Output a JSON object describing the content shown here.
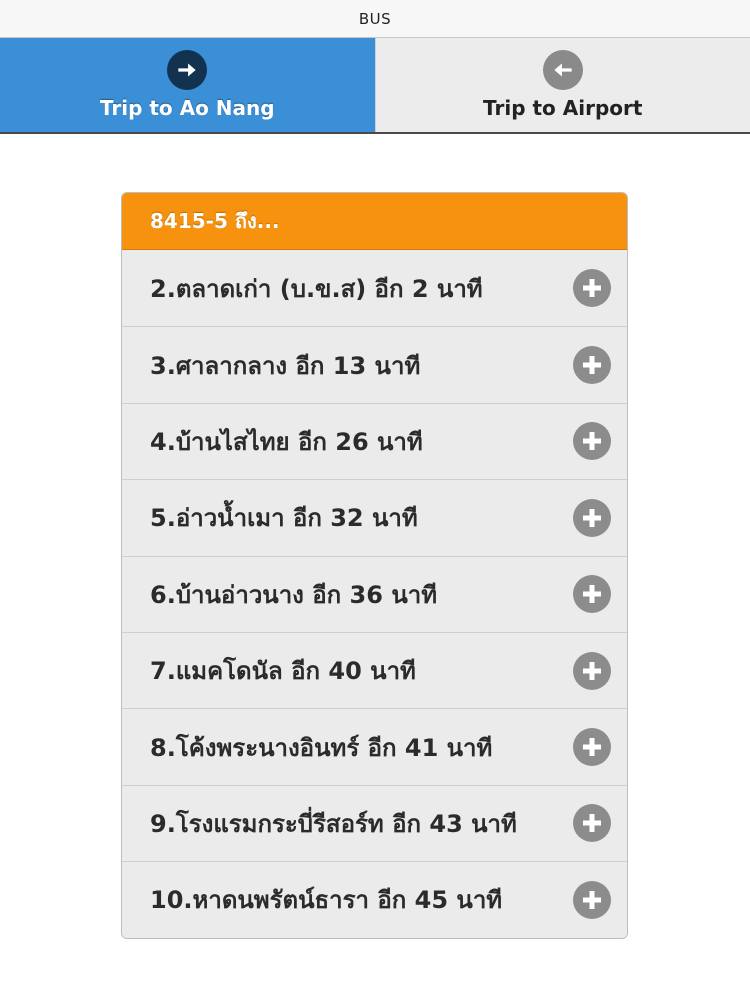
{
  "window": {
    "title": "BUS"
  },
  "tabs": [
    {
      "label": "Trip to Ao Nang",
      "icon": "arrow-right-icon",
      "active": true
    },
    {
      "label": "Trip to Airport",
      "icon": "arrow-left-icon",
      "active": false
    }
  ],
  "route": {
    "header": "8415-5 ถึง...",
    "stops": [
      {
        "label": "2.ตลาดเก่า (บ.ข.ส) อีก 2 นาที",
        "icon": "plus-circle-icon"
      },
      {
        "label": "3.ศาลากลาง อีก 13 นาที",
        "icon": "plus-circle-icon"
      },
      {
        "label": "4.บ้านไสไทย อีก 26 นาที",
        "icon": "plus-circle-icon"
      },
      {
        "label": "5.อ่าวน้ำเมา อีก 32 นาที",
        "icon": "plus-circle-icon"
      },
      {
        "label": "6.บ้านอ่าวนาง อีก 36 นาที",
        "icon": "plus-circle-icon"
      },
      {
        "label": "7.แมคโดนัล อีก 40 นาที",
        "icon": "plus-circle-icon"
      },
      {
        "label": "8.โค้งพระนางอินทร์ อีก 41 นาที",
        "icon": "plus-circle-icon"
      },
      {
        "label": "9.โรงแรมกระบี่รีสอร์ท อีก 43 นาที",
        "icon": "plus-circle-icon"
      },
      {
        "label": "10.หาดนพรัตน์ธารา อีก 45 นาที",
        "icon": "plus-circle-icon"
      }
    ]
  },
  "colors": {
    "tab_active": "#3a8fd6",
    "tab_inactive": "#ececec",
    "header_orange": "#f7920f",
    "row_bg": "#ebebeb",
    "icon_gray": "#8c8c8c"
  }
}
